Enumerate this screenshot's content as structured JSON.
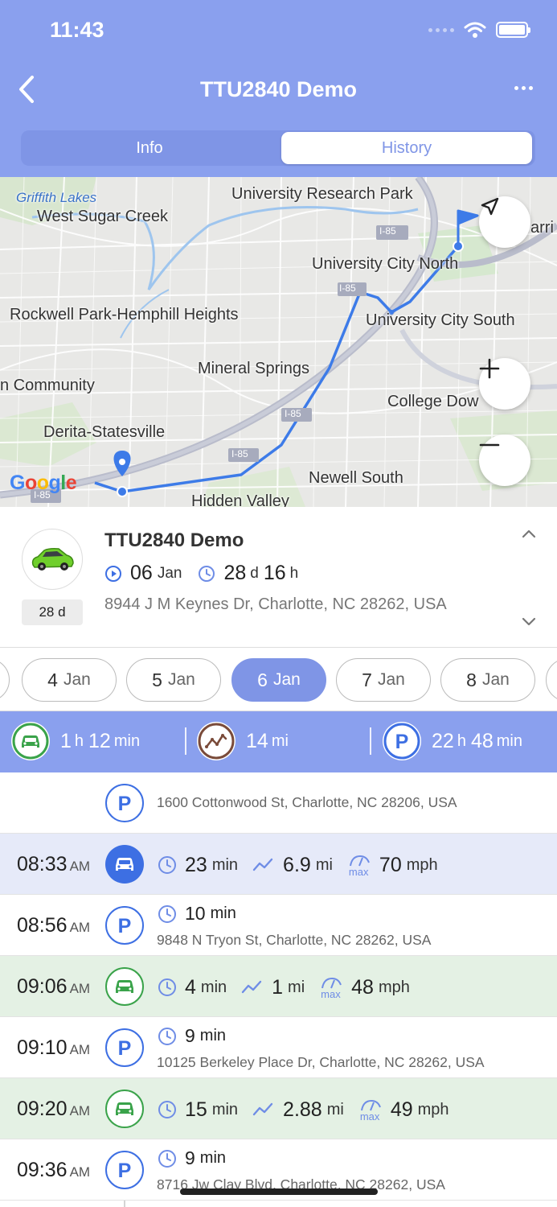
{
  "status_bar": {
    "time": "11:43"
  },
  "header": {
    "title": "TTU2840 Demo"
  },
  "tabs": [
    {
      "label": "Info",
      "active": false
    },
    {
      "label": "History",
      "active": true
    }
  ],
  "map": {
    "labels": {
      "griffith_lakes": "Griffith Lakes",
      "west_sugar_creek": "West Sugar Creek",
      "university_research_park": "University Research Park",
      "university_city_north": "University City North",
      "rockwell_park": "Rockwell Park-Hemphill Heights",
      "university_city_south": "University City South",
      "mineral_springs": "Mineral Springs",
      "community": "n Community",
      "college_downs": "College Dow",
      "derita": "Derita-Statesville",
      "newell_south": "Newell South",
      "hidden_valley": "Hidden Valley",
      "harris_partial": "arri"
    },
    "highway_labels": {
      "i85_a": "I-85",
      "i85_b": "I-85",
      "i85_c": "I-85",
      "i85_d": "I-85",
      "i85_e": "I-85"
    },
    "attribution": "Google",
    "route_color": "#3d7be8"
  },
  "vehicle": {
    "name": "TTU2840 Demo",
    "start_day": "06",
    "start_month": "Jan",
    "duration_days": "28",
    "duration_days_unit": "d",
    "duration_hours": "16",
    "duration_hours_unit": "h",
    "address": "8944 J M Keynes Dr, Charlotte, NC 28262, USA",
    "days_badge": "28 d"
  },
  "dates": [
    {
      "day": "4",
      "month": "Jan",
      "active": false
    },
    {
      "day": "5",
      "month": "Jan",
      "active": false
    },
    {
      "day": "6",
      "month": "Jan",
      "active": true
    },
    {
      "day": "7",
      "month": "Jan",
      "active": false
    },
    {
      "day": "8",
      "month": "Jan",
      "active": false
    }
  ],
  "summary": {
    "drive_h": "1",
    "drive_h_unit": "h",
    "drive_m": "12",
    "drive_m_unit": "min",
    "distance": "14",
    "distance_unit": "mi",
    "park_h": "22",
    "park_h_unit": "h",
    "park_m": "48",
    "park_m_unit": "min"
  },
  "timeline": {
    "first_address": "1600 Cottonwood St, Charlotte, NC 28206, USA",
    "rows": [
      {
        "type": "drive-active",
        "time": "08:33",
        "ampm": "AM",
        "duration": "23",
        "duration_unit": "min",
        "distance": "6.9",
        "distance_unit": "mi",
        "max_label": "max",
        "speed": "70",
        "speed_unit": "mph"
      },
      {
        "type": "park",
        "time": "08:56",
        "ampm": "AM",
        "duration": "10",
        "duration_unit": "min",
        "address": "9848 N Tryon St, Charlotte, NC 28262, USA"
      },
      {
        "type": "drive",
        "time": "09:06",
        "ampm": "AM",
        "duration": "4",
        "duration_unit": "min",
        "distance": "1",
        "distance_unit": "mi",
        "max_label": "max",
        "speed": "48",
        "speed_unit": "mph"
      },
      {
        "type": "park",
        "time": "09:10",
        "ampm": "AM",
        "duration": "9",
        "duration_unit": "min",
        "address": "10125 Berkeley Place Dr, Charlotte, NC 28262, USA"
      },
      {
        "type": "drive",
        "time": "09:20",
        "ampm": "AM",
        "duration": "15",
        "duration_unit": "min",
        "distance": "2.88",
        "distance_unit": "mi",
        "max_label": "max",
        "speed": "49",
        "speed_unit": "mph"
      },
      {
        "type": "park",
        "time": "09:36",
        "ampm": "AM",
        "duration": "9",
        "duration_unit": "min",
        "address": "8716 Jw Clay Blvd, Charlotte, NC 28262, USA"
      }
    ]
  },
  "colors": {
    "header": "#8aa0ee",
    "accent": "#3d6fe3",
    "drive_green": "#3aa34a",
    "park_blue": "#3d6fe3",
    "trip_brown": "#7a4b3a"
  }
}
